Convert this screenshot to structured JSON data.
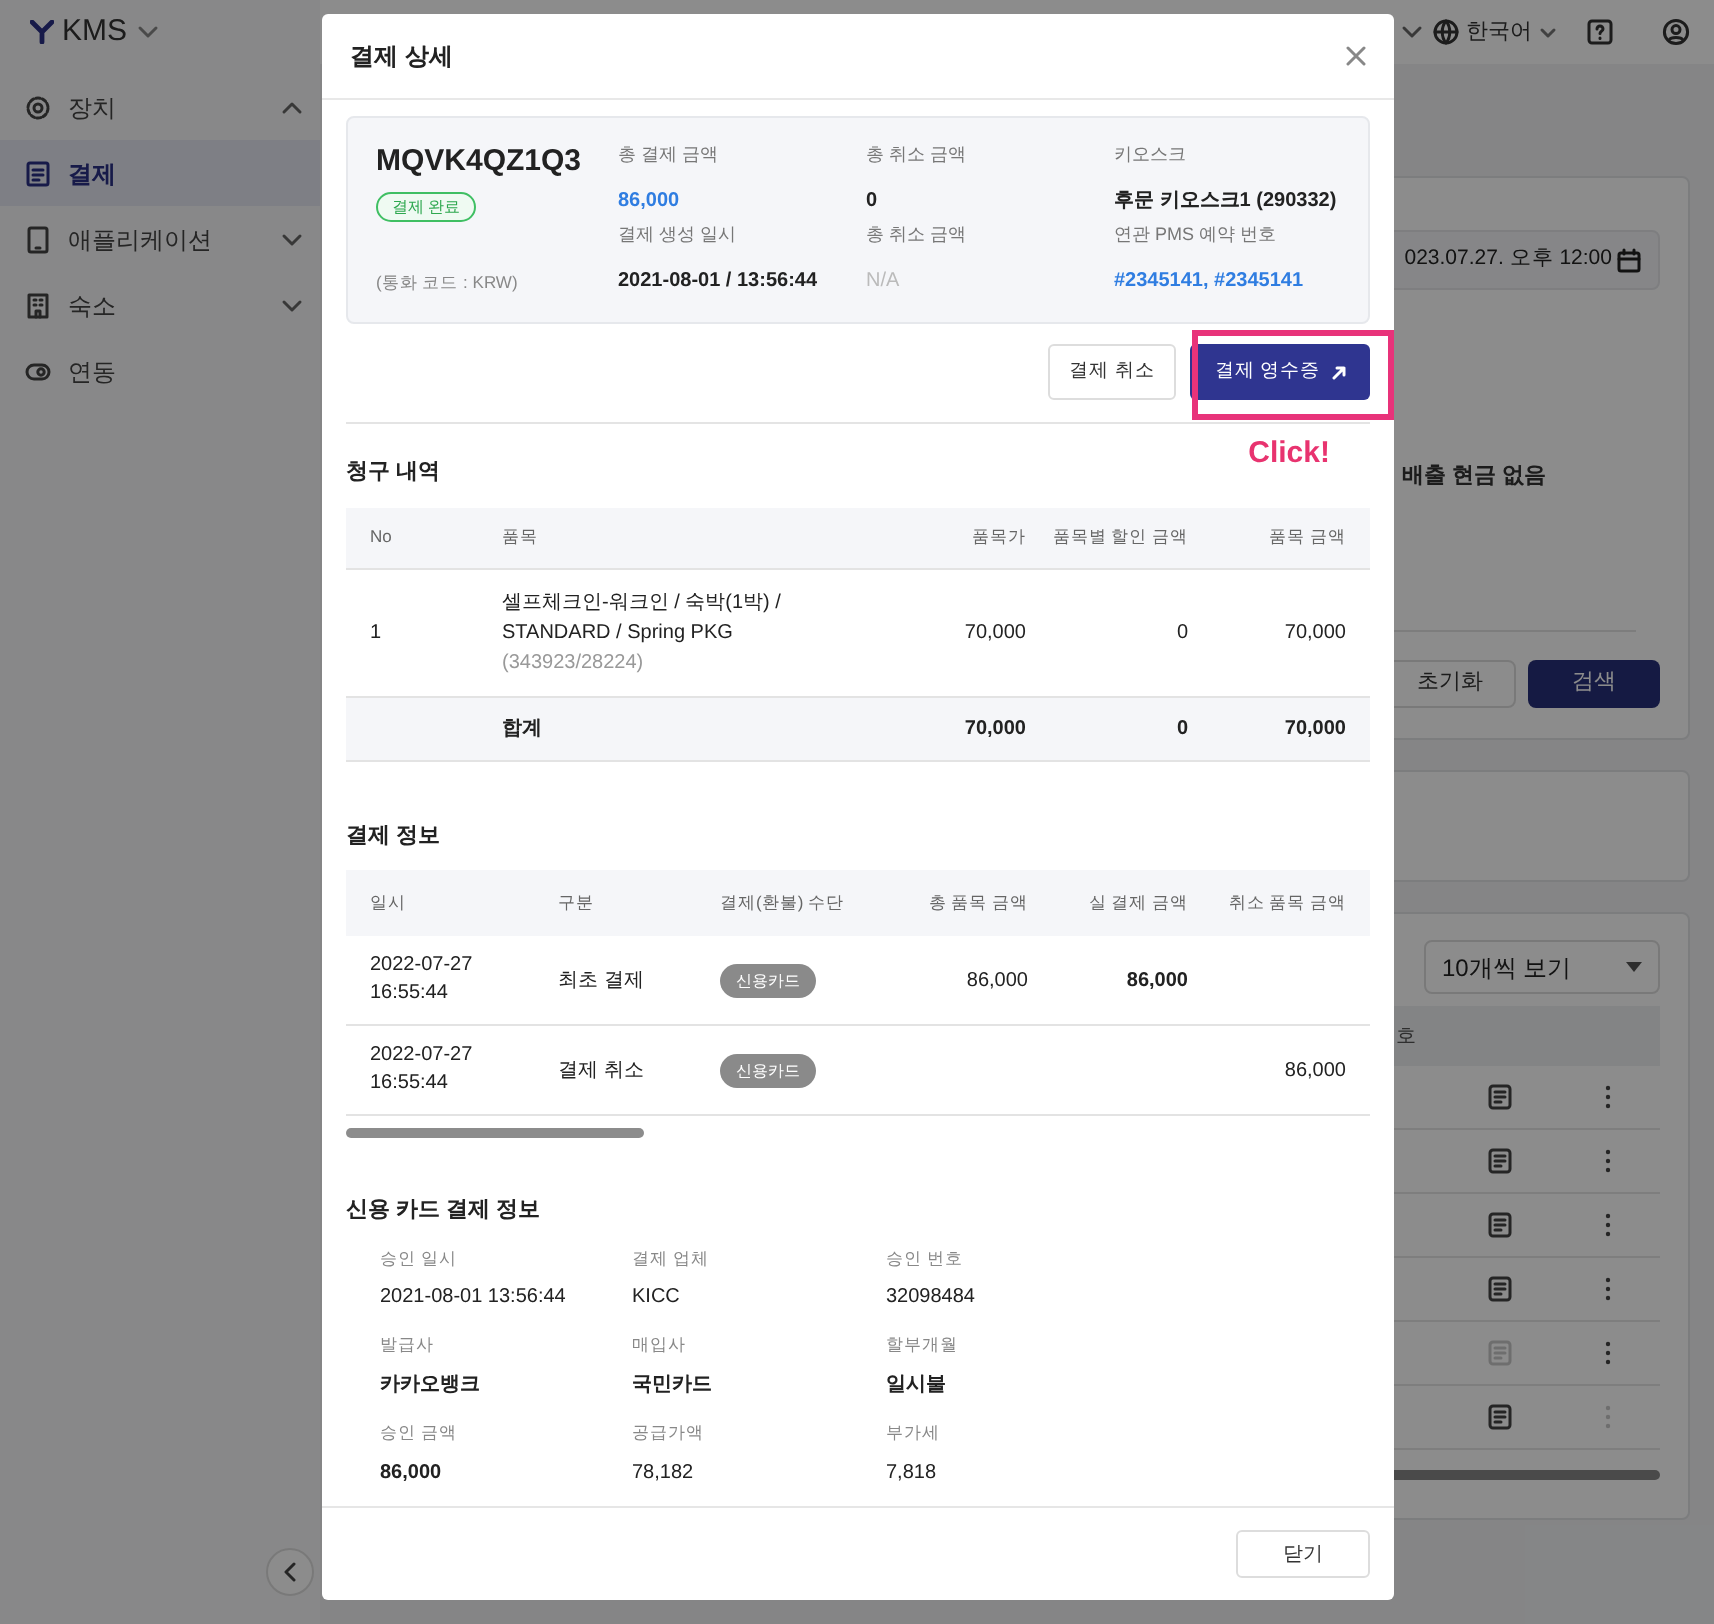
{
  "app": {
    "logo": "KMS"
  },
  "sidebar": {
    "items": [
      {
        "label": "장치",
        "kind": "group",
        "expanded": true,
        "selected": false
      },
      {
        "label": "결제",
        "kind": "link",
        "selected": true
      },
      {
        "label": "애플리케이션",
        "kind": "group",
        "expanded": false,
        "selected": false
      },
      {
        "label": "숙소",
        "kind": "group",
        "expanded": false,
        "selected": false
      },
      {
        "label": "연동",
        "kind": "link",
        "selected": false
      }
    ]
  },
  "header": {
    "language": "한국어"
  },
  "background": {
    "date_value": "023.07.27. 오후 12:00",
    "note": "배출 현금 없음",
    "buttons": [
      "초기화",
      "검색"
    ],
    "page_size": "10개씩 보기",
    "column_partial": "호",
    "rows": [
      {
        "receipt_disabled": false,
        "menu_disabled": false
      },
      {
        "receipt_disabled": false,
        "menu_disabled": false
      },
      {
        "receipt_disabled": false,
        "menu_disabled": false
      },
      {
        "receipt_disabled": false,
        "menu_disabled": false
      },
      {
        "receipt_disabled": true,
        "menu_disabled": false
      },
      {
        "receipt_disabled": false,
        "menu_disabled": true
      }
    ]
  },
  "modal": {
    "title": "결제 상세",
    "payment_id": "MQVK4QZ1Q3",
    "status": "결제 완료",
    "currency_note": "(통화 코드 : KRW)",
    "summary": [
      {
        "label": "총 결제 금액",
        "value": "86,000",
        "kind": "amount"
      },
      {
        "label": "총 취소 금액",
        "value": "0",
        "kind": "plain"
      },
      {
        "label": "키오스크",
        "value": "후문 키오스크1 (290332)",
        "kind": "plain"
      },
      {
        "label": "결제 생성 일시",
        "value": "2021-08-01 / 13:56:44",
        "kind": "plain"
      },
      {
        "label": "총 취소 금액",
        "value": "N/A",
        "kind": "muted"
      },
      {
        "label": "연관 PMS 예약 번호",
        "value": "#2345141, #2345141",
        "kind": "link"
      }
    ],
    "actions": [
      {
        "label": "결제 취소",
        "kind": "secondary"
      },
      {
        "label": "결제 영수증",
        "kind": "primary"
      }
    ],
    "annotation": "Click!",
    "billing": {
      "title": "청구 내역",
      "columns": [
        "No",
        "품목",
        "품목가",
        "품목별 할인 금액",
        "품목 금액"
      ],
      "rows": [
        {
          "no": "1",
          "item": "셀프체크인-워크인 / 숙박(1박) / STANDARD / Spring PKG",
          "code": "(343923/28224)",
          "price": "70,000",
          "discount": "0",
          "amount": "70,000"
        }
      ],
      "total": {
        "label": "합계",
        "price": "70,000",
        "discount": "0",
        "amount": "70,000"
      }
    },
    "payment_info": {
      "title": "결제 정보",
      "columns": [
        "일시",
        "구분",
        "결제(환불) 수단",
        "총 품목 금액",
        "실 결제 금액",
        "취소 품목 금액"
      ],
      "rows": [
        {
          "datetime": "2022-07-27 16:55:44",
          "type": "최초 결제",
          "method": "신용카드",
          "total": "86,000",
          "paid": "86,000"
        },
        {
          "datetime": "2022-07-27 16:55:44",
          "type": "결제 취소",
          "method": "신용카드",
          "cancelled": "86,000"
        }
      ]
    },
    "card_info": {
      "title": "신용 카드 결제 정보",
      "fields": [
        {
          "label": "승인 일시",
          "value": "2021-08-01 13:56:44",
          "kind": "plain"
        },
        {
          "label": "결제 업체",
          "value": "KICC",
          "kind": "plain"
        },
        {
          "label": "승인 번호",
          "value": "32098484",
          "kind": "plain"
        },
        {
          "label": "발급사",
          "value": "카카오뱅크",
          "kind": "strong"
        },
        {
          "label": "매입사",
          "value": "국민카드",
          "kind": "strong"
        },
        {
          "label": "할부개월",
          "value": "일시불",
          "kind": "strong"
        },
        {
          "label": "승인 금액",
          "value": "86,000",
          "kind": "strong"
        },
        {
          "label": "공급가액",
          "value": "78,182",
          "kind": "plain"
        },
        {
          "label": "부가세",
          "value": "7,818",
          "kind": "plain"
        }
      ]
    },
    "close_button": "닫기"
  }
}
